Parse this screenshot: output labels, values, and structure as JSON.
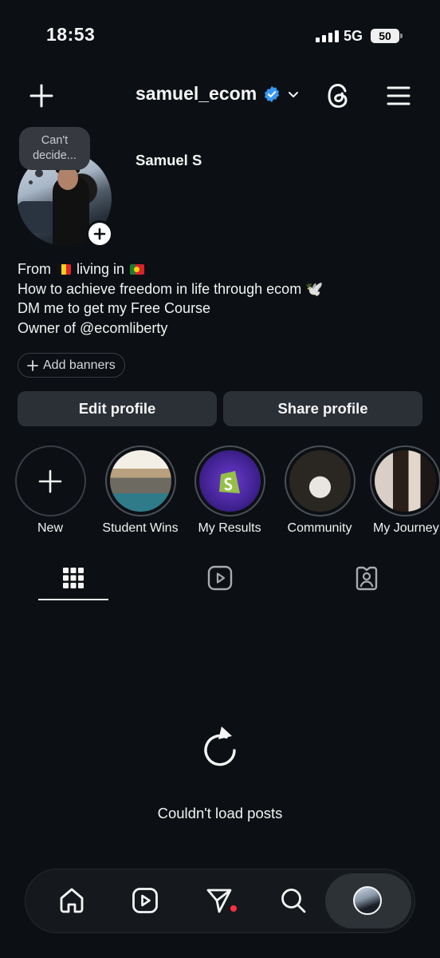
{
  "status_bar": {
    "time": "18:53",
    "network": "5G",
    "battery": "50"
  },
  "header": {
    "username": "samuel_ecom",
    "verified": true,
    "icons": [
      "plus-icon",
      "chevron-down-icon",
      "threads-icon",
      "menu-icon"
    ]
  },
  "profile": {
    "note": "Can't decide...",
    "display_name": "Samuel S",
    "bio": {
      "line1_a": "From",
      "line1_b": "living in",
      "line2": "How to achieve freedom in life through ecom 🕊️",
      "line3": "DM me to get my Free Course",
      "line4": "Owner of @ecomliberty"
    },
    "add_banners": "Add banners",
    "edit_button": "Edit profile",
    "share_button": "Share profile"
  },
  "highlights": [
    {
      "label": "New"
    },
    {
      "label": "Student Wins"
    },
    {
      "label": "My Results"
    },
    {
      "label": "Community"
    },
    {
      "label": "My Journey"
    }
  ],
  "tabs": [
    "grid-icon",
    "reels-icon",
    "tagged-icon"
  ],
  "content": {
    "message": "Couldn't load posts"
  },
  "bottom_nav": [
    "home-icon",
    "reels-icon",
    "send-icon",
    "search-icon",
    "profile-avatar"
  ],
  "colors": {
    "background": "#0c1014",
    "button": "#2b3036",
    "verified": "#3897f0",
    "notification": "#ff3040"
  }
}
